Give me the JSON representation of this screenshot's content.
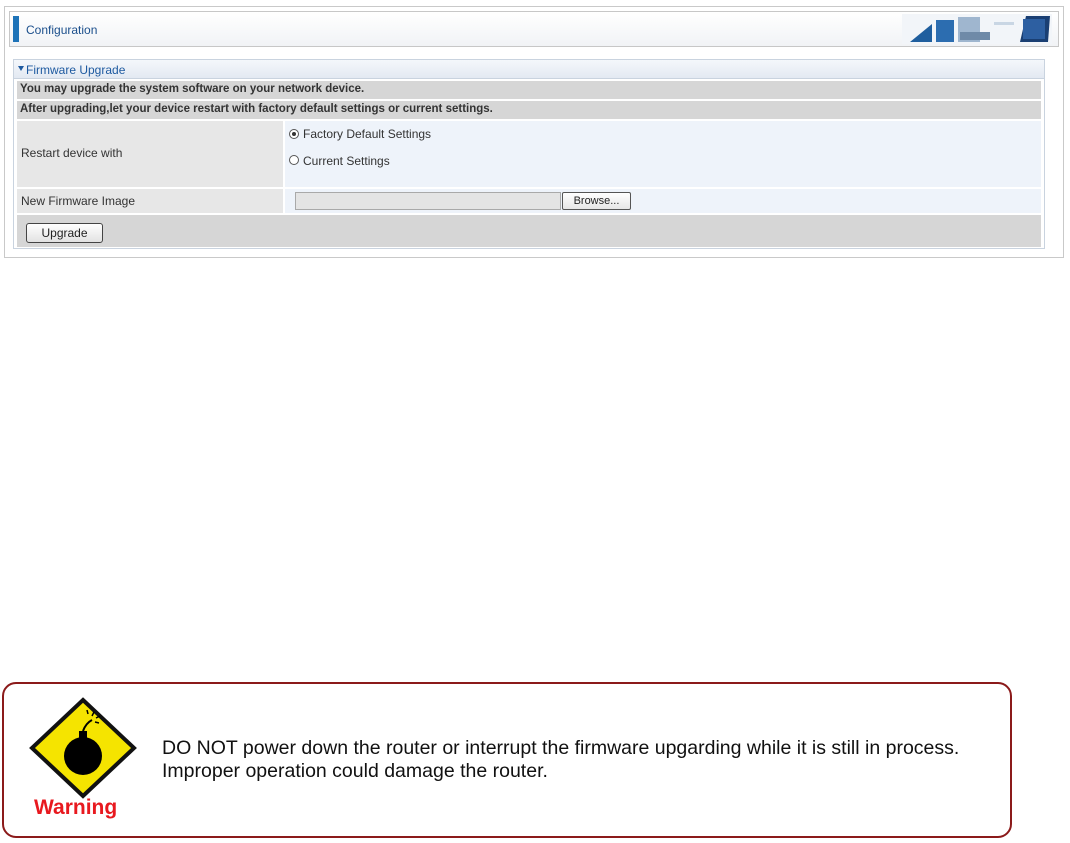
{
  "header": {
    "title": "Configuration"
  },
  "panel": {
    "title": "Firmware Upgrade",
    "info_lines": [
      "You may upgrade the system software on your network device.",
      "After upgrading,let your device restart with factory default settings or current settings."
    ],
    "restart_label": "Restart device with",
    "options": [
      {
        "label": "Factory Default Settings",
        "checked": true
      },
      {
        "label": "Current Settings",
        "checked": false
      }
    ],
    "firmware_label": "New Firmware Image",
    "firmware_value": "",
    "browse_label": "Browse...",
    "upgrade_label": "Upgrade"
  },
  "warning": {
    "caption": "Warning",
    "text": "DO NOT power down the router or interrupt the firmware upgarding while it is still in process. Improper operation could damage the router.",
    "icon": "bomb-warning-icon",
    "colors": {
      "border": "#8b1a1a",
      "caption": "#e8191f",
      "sign": "#f5e400"
    }
  }
}
